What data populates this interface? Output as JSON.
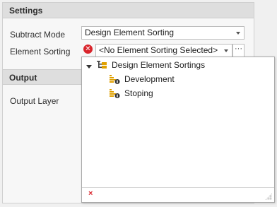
{
  "settings": {
    "header": "Settings",
    "subtract_mode_label": "Subtract Mode",
    "subtract_mode_value": "Design Element Sorting",
    "element_sorting_label": "Element Sorting",
    "element_sorting_value": "<No Element Sorting Selected>",
    "ellipsis": "···"
  },
  "output": {
    "header": "Output",
    "output_layer_label": "Output Layer"
  },
  "dropdown": {
    "root": "Design Element Sortings",
    "items": [
      "Development",
      "Stoping"
    ],
    "clear": "×"
  },
  "colors": {
    "error": "#d9242b",
    "sort_icon": "#e0a000"
  }
}
